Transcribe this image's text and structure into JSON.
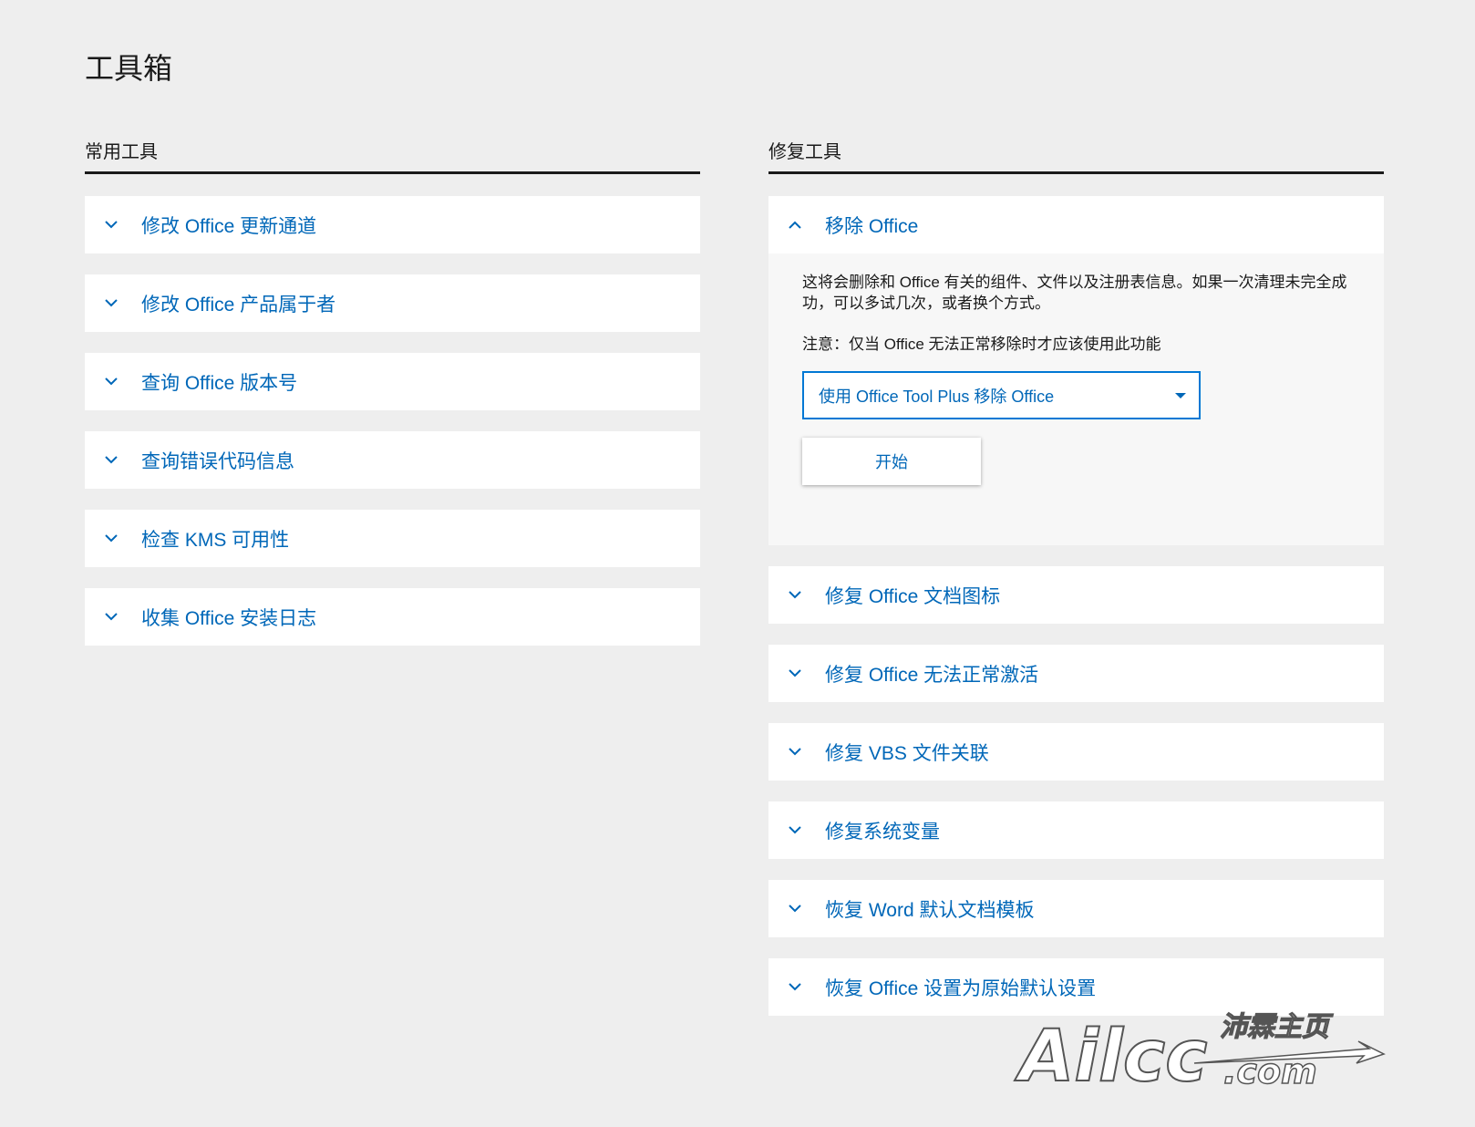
{
  "page": {
    "title": "工具箱"
  },
  "common_tools": {
    "header": "常用工具",
    "items": [
      {
        "label": "修改 Office 更新通道"
      },
      {
        "label": "修改 Office 产品属于者"
      },
      {
        "label": "查询 Office 版本号"
      },
      {
        "label": "查询错误代码信息"
      },
      {
        "label": "检查 KMS 可用性"
      },
      {
        "label": "收集 Office 安装日志"
      }
    ]
  },
  "repair_tools": {
    "header": "修复工具",
    "expanded": {
      "label": "移除 Office",
      "description": "这将会删除和 Office 有关的组件、文件以及注册表信息。如果一次清理未完全成功，可以多试几次，或者换个方式。",
      "note": "注意：仅当 Office 无法正常移除时才应该使用此功能",
      "method_select": {
        "value": "使用 Office Tool Plus 移除 Office"
      },
      "start_button": "开始"
    },
    "items": [
      {
        "label": "修复 Office 文档图标"
      },
      {
        "label": "修复 Office 无法正常激活"
      },
      {
        "label": "修复 VBS 文件关联"
      },
      {
        "label": "修复系统变量"
      },
      {
        "label": "恢复 Word 默认文档模板"
      },
      {
        "label": "恢复 Office 设置为原始默认设置"
      }
    ]
  },
  "watermark": {
    "brand": "Ailcc",
    "tagline": "沛霖主页",
    "domain": ".com"
  },
  "colors": {
    "accent": "#0067b8",
    "background": "#eeeeee",
    "card": "#ffffff"
  }
}
